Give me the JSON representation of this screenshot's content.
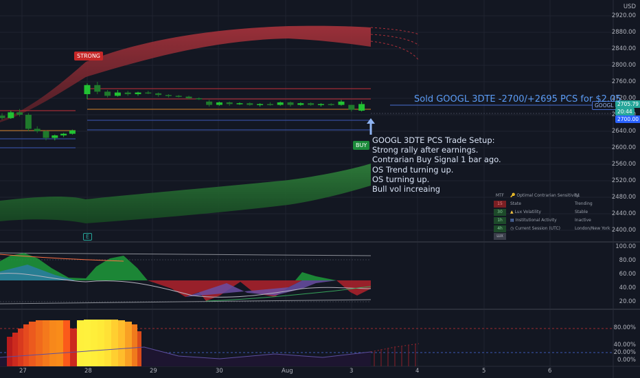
{
  "currency": "USD",
  "price_axis": [
    "2920.00",
    "2880.00",
    "2840.00",
    "2800.00",
    "2760.00",
    "2720.00",
    "2680.00",
    "2640.00",
    "2600.00",
    "2560.00",
    "2520.00",
    "2480.00",
    "2440.00",
    "2400.00"
  ],
  "osc1_axis": [
    "100.00",
    "80.00",
    "60.00",
    "40.00",
    "20.00"
  ],
  "osc2_axis": [
    "80.00%",
    "40.00%",
    "20.00%",
    "0.00%"
  ],
  "x_axis": [
    "27",
    "28",
    "29",
    "30",
    "Aug",
    "3",
    "4",
    "5",
    "6"
  ],
  "price_badges": {
    "ticker": "GOOGL",
    "last": "2705.79",
    "countdown": "20:44",
    "level": "2700.00"
  },
  "annotations": {
    "sold": "Sold GOOGL 3DTE -2700/+2695 PCS for $2.05",
    "setup_lines": [
      "GOOGL 3DTE PCS Trade Setup:",
      "Strong rally after earnings.",
      "Contrarian Buy Signal 1 bar ago.",
      "OS Trend turning up.",
      "OS turning up.",
      "Bull vol increaing"
    ],
    "strong_label": "STRONG",
    "buy_label": "BUY",
    "earnings_label": "E"
  },
  "dashboard": {
    "header": "MTF",
    "rows": [
      {
        "tf": "",
        "icon": "key-icon",
        "name": "Optimal Contrarian Sensitivity",
        "value": "11",
        "color": ""
      },
      {
        "tf": "15",
        "icon": "",
        "name": "State",
        "value": "Trending",
        "color": "#7a1f23"
      },
      {
        "tf": "30",
        "icon": "warning-icon",
        "name": "Lux Volatility",
        "value": "Stable",
        "color": "#1d4a2a"
      },
      {
        "tf": "1h",
        "icon": "chart-icon",
        "name": "Institutional Activity",
        "value": "Inactive",
        "color": "#1d4a2a"
      },
      {
        "tf": "4h",
        "icon": "clock-icon",
        "name": "Current Session (UTC)",
        "value": "London/New York",
        "color": "#1d4a2a"
      }
    ],
    "footer": "LUX"
  },
  "colors": {
    "bull": "#22c233",
    "bear": "#1f7a2c",
    "upper_band": "#b0303a",
    "lower_band": "#2f8a3e",
    "accent_blue": "#2962ff"
  },
  "chart_data": {
    "type": "candlestick",
    "price_range": [
      2380,
      2930
    ],
    "candles": [
      {
        "o": 2678,
        "h": 2684,
        "l": 2668,
        "c": 2672
      },
      {
        "o": 2672,
        "h": 2690,
        "l": 2670,
        "c": 2686
      },
      {
        "o": 2686,
        "h": 2694,
        "l": 2676,
        "c": 2680
      },
      {
        "o": 2680,
        "h": 2684,
        "l": 2640,
        "c": 2646
      },
      {
        "o": 2646,
        "h": 2652,
        "l": 2636,
        "c": 2640
      },
      {
        "o": 2640,
        "h": 2642,
        "l": 2618,
        "c": 2624
      },
      {
        "o": 2624,
        "h": 2632,
        "l": 2618,
        "c": 2630
      },
      {
        "o": 2630,
        "h": 2636,
        "l": 2626,
        "c": 2634
      },
      {
        "o": 2634,
        "h": 2644,
        "l": 2632,
        "c": 2642
      },
      {
        "o": 2730,
        "h": 2756,
        "l": 2718,
        "c": 2752
      },
      {
        "o": 2752,
        "h": 2760,
        "l": 2730,
        "c": 2736
      },
      {
        "o": 2736,
        "h": 2740,
        "l": 2722,
        "c": 2726
      },
      {
        "o": 2726,
        "h": 2740,
        "l": 2724,
        "c": 2734
      },
      {
        "o": 2734,
        "h": 2738,
        "l": 2726,
        "c": 2730
      },
      {
        "o": 2730,
        "h": 2736,
        "l": 2726,
        "c": 2734
      },
      {
        "o": 2734,
        "h": 2738,
        "l": 2730,
        "c": 2732
      },
      {
        "o": 2732,
        "h": 2734,
        "l": 2724,
        "c": 2728
      },
      {
        "o": 2728,
        "h": 2730,
        "l": 2722,
        "c": 2726
      },
      {
        "o": 2726,
        "h": 2728,
        "l": 2722,
        "c": 2724
      },
      {
        "o": 2724,
        "h": 2726,
        "l": 2718,
        "c": 2720
      },
      {
        "o": 2720,
        "h": 2722,
        "l": 2716,
        "c": 2718
      },
      {
        "o": 2712,
        "h": 2716,
        "l": 2700,
        "c": 2704
      },
      {
        "o": 2704,
        "h": 2712,
        "l": 2702,
        "c": 2710
      },
      {
        "o": 2710,
        "h": 2712,
        "l": 2702,
        "c": 2706
      },
      {
        "o": 2706,
        "h": 2710,
        "l": 2704,
        "c": 2708
      },
      {
        "o": 2708,
        "h": 2710,
        "l": 2702,
        "c": 2704
      },
      {
        "o": 2704,
        "h": 2708,
        "l": 2700,
        "c": 2706
      },
      {
        "o": 2706,
        "h": 2710,
        "l": 2702,
        "c": 2704
      },
      {
        "o": 2704,
        "h": 2712,
        "l": 2702,
        "c": 2710
      },
      {
        "o": 2710,
        "h": 2712,
        "l": 2700,
        "c": 2704
      },
      {
        "o": 2704,
        "h": 2710,
        "l": 2702,
        "c": 2708
      },
      {
        "o": 2708,
        "h": 2710,
        "l": 2702,
        "c": 2704
      },
      {
        "o": 2704,
        "h": 2708,
        "l": 2700,
        "c": 2706
      },
      {
        "o": 2706,
        "h": 2708,
        "l": 2702,
        "c": 2704
      },
      {
        "o": 2704,
        "h": 2716,
        "l": 2702,
        "c": 2712
      },
      {
        "o": 2704,
        "h": 2704,
        "l": 2688,
        "c": 2692
      },
      {
        "o": 2690,
        "h": 2712,
        "l": 2688,
        "c": 2706
      }
    ]
  }
}
